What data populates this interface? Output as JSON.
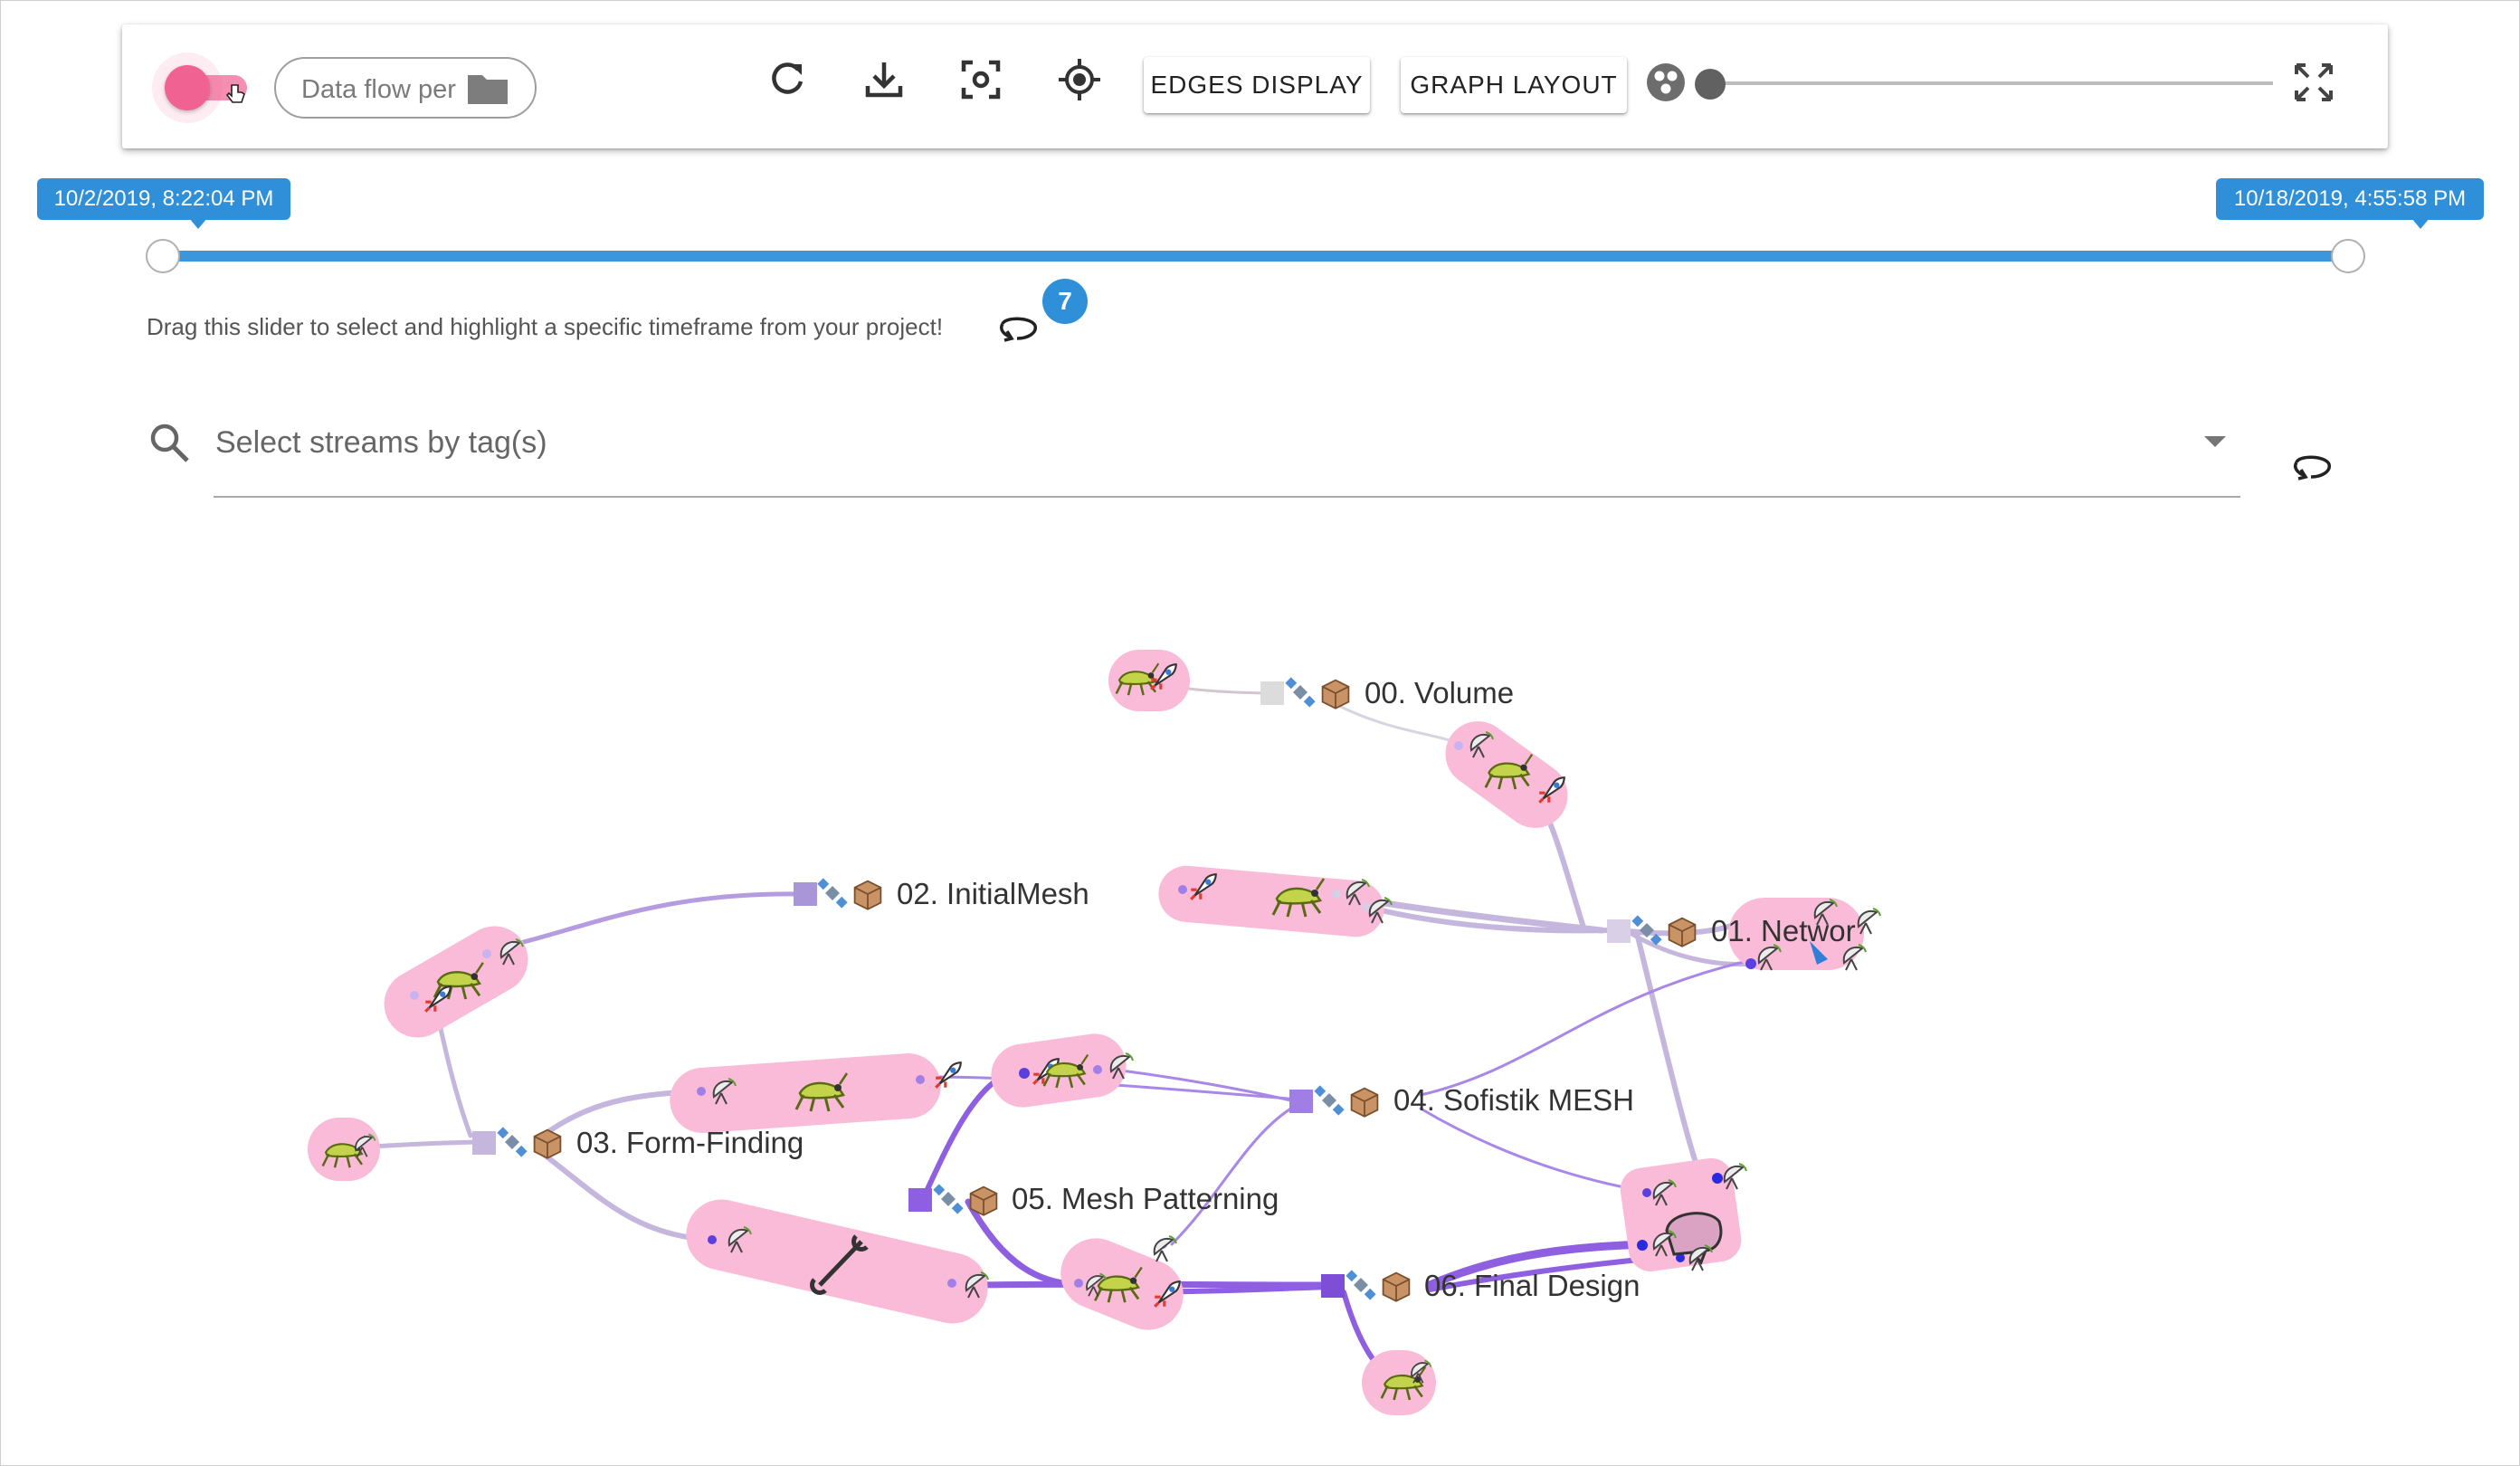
{
  "toolbar": {
    "toggle_on": true,
    "chip_label": "Data flow per",
    "chip_icon": "folder-icon",
    "icons": [
      "refresh-icon",
      "download-icon",
      "focus-screenshot-icon",
      "locate-target-icon"
    ],
    "edges_display_label": "EDGES DISPLAY",
    "graph_layout_label": "GRAPH LAYOUT",
    "zoom_icon": "cluster-icon",
    "fullscreen_icon": "fullscreen-icon",
    "zoom_level": 0
  },
  "timeline": {
    "start_label": "10/2/2019, 8:22:04 PM",
    "end_label": "10/18/2019, 4:55:58 PM",
    "range_fraction": [
      0,
      1
    ],
    "hint": "Drag this slider to select and highlight a specific timeframe from your project!",
    "badge_count": "7"
  },
  "search": {
    "placeholder": "Select streams by tag(s)",
    "value": ""
  },
  "graph": {
    "streams": [
      "00. Volume",
      "01. Networ",
      "02. InitialMesh",
      "03. Form-Finding",
      "04. Sofistik MESH",
      "05. Mesh Patterning",
      "06. Final Design"
    ],
    "colors": {
      "accent_pink": "#f06292",
      "node_pink": "#f9bbd7",
      "edge_purple": "#8e5fe0",
      "edge_light": "#c5b6dd",
      "timeline_blue": "#2f8fd8"
    }
  }
}
